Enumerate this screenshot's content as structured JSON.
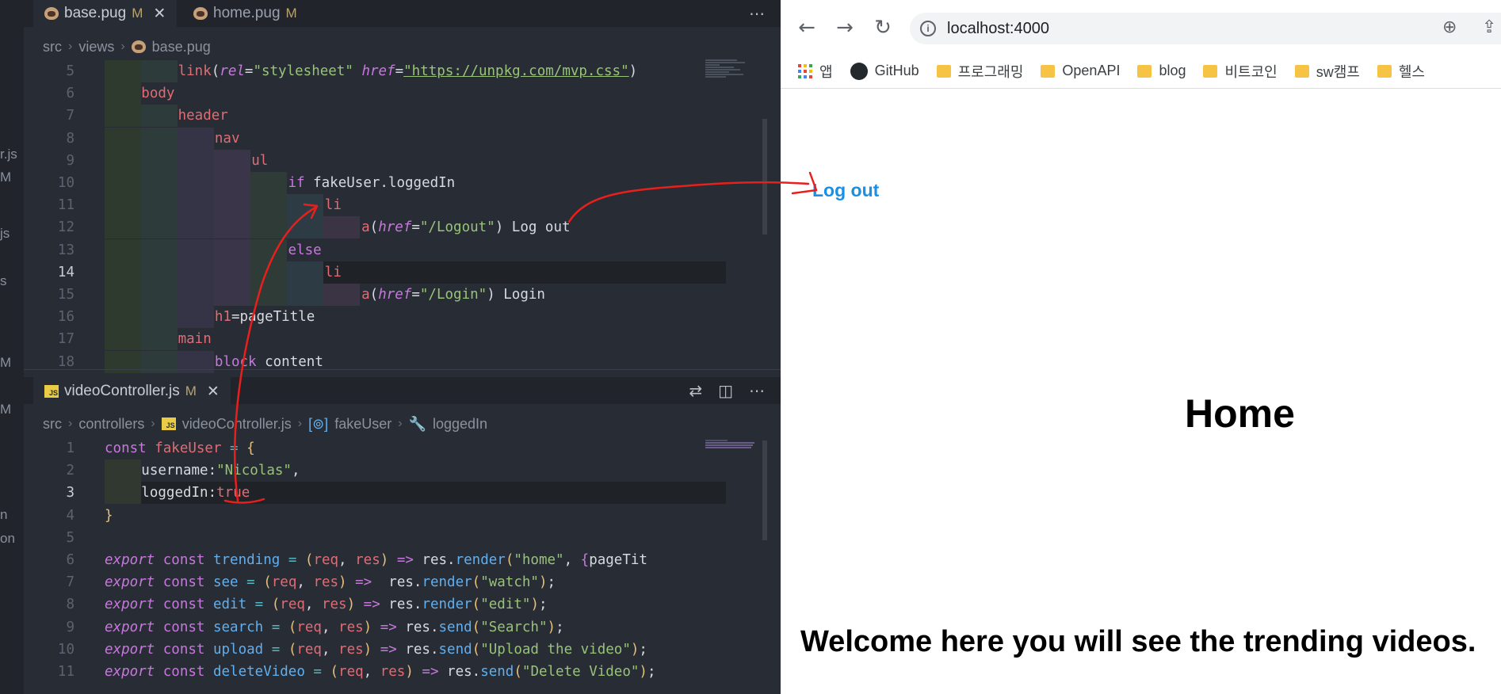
{
  "editor": {
    "top_tabs": [
      {
        "name": "base.pug",
        "status": "M",
        "active": true
      },
      {
        "name": "home.pug",
        "status": "M",
        "active": false
      }
    ],
    "top_breadcrumb": [
      "src",
      "views",
      "base.pug"
    ],
    "side_strip": [
      "r.js",
      "M",
      "js",
      "s",
      "M",
      "M",
      "n",
      "on"
    ],
    "pug_lines": [
      {
        "n": "5",
        "level": 2,
        "tokens": [
          [
            "link",
            "tag"
          ],
          [
            "(",
            "def"
          ],
          [
            "rel",
            "attr"
          ],
          [
            "=",
            "def"
          ],
          [
            "\"stylesheet\"",
            "def"
          ],
          [
            " ",
            "def"
          ],
          [
            "href",
            "attr"
          ],
          [
            "=",
            "def"
          ],
          [
            "\"https://unpkg.com/mvp.css\"",
            "def"
          ],
          [
            ")",
            "def"
          ]
        ]
      },
      {
        "n": "6",
        "level": 1,
        "tokens": [
          [
            "body",
            "tag"
          ]
        ]
      },
      {
        "n": "7",
        "level": 2,
        "tokens": [
          [
            "header",
            "tag"
          ]
        ]
      },
      {
        "n": "8",
        "level": 3,
        "tokens": [
          [
            "nav",
            "tag"
          ]
        ]
      },
      {
        "n": "9",
        "level": 4,
        "tokens": [
          [
            "ul",
            "tag"
          ]
        ]
      },
      {
        "n": "10",
        "level": 5,
        "tokens": [
          [
            "if ",
            "kw"
          ],
          [
            "fakeUser.loggedIn",
            "def"
          ]
        ]
      },
      {
        "n": "11",
        "level": 6,
        "tokens": [
          [
            "li",
            "tag"
          ]
        ]
      },
      {
        "n": "12",
        "level": 7,
        "tokens": [
          [
            "a",
            "tag"
          ],
          [
            "(",
            "def"
          ],
          [
            "href",
            "attr"
          ],
          [
            "=",
            "def"
          ],
          [
            "\"/Logout\"",
            "def"
          ],
          [
            ") Log out",
            "def"
          ]
        ]
      },
      {
        "n": "13",
        "level": 5,
        "tokens": [
          [
            "else",
            "kw"
          ]
        ]
      },
      {
        "n": "14",
        "level": 6,
        "current": true,
        "tokens": [
          [
            "li",
            "tag"
          ]
        ]
      },
      {
        "n": "15",
        "level": 7,
        "tokens": [
          [
            "a",
            "tag"
          ],
          [
            "(",
            "def"
          ],
          [
            "href",
            "attr"
          ],
          [
            "=",
            "def"
          ],
          [
            "\"/Login\"",
            "def"
          ],
          [
            ") Login",
            "def"
          ]
        ]
      },
      {
        "n": "16",
        "level": 3,
        "tokens": [
          [
            "h1",
            "tag"
          ],
          [
            "=pageTitle",
            "def"
          ]
        ]
      },
      {
        "n": "17",
        "level": 2,
        "tokens": [
          [
            "main",
            "tag"
          ]
        ]
      },
      {
        "n": "18",
        "level": 3,
        "tokens": [
          [
            "block ",
            "kw"
          ],
          [
            "content",
            "def"
          ]
        ]
      }
    ],
    "bottom_tab": {
      "name": "videoController.js",
      "status": "M"
    },
    "bottom_breadcrumb": [
      "src",
      "controllers",
      "videoController.js",
      "fakeUser",
      "loggedIn"
    ],
    "js_lines": [
      {
        "n": "1",
        "level": 0,
        "tokens": [
          [
            "const ",
            "kw"
          ],
          [
            "fakeUser",
            "param"
          ],
          [
            " = ",
            "op"
          ],
          [
            "{",
            "br"
          ]
        ]
      },
      {
        "n": "2",
        "level": 1,
        "tokens": [
          [
            "username",
            "def"
          ],
          [
            ":",
            "def"
          ],
          [
            "\"Nicolas\"",
            "str"
          ],
          [
            ",",
            "def"
          ]
        ]
      },
      {
        "n": "3",
        "level": 1,
        "current": true,
        "tokens": [
          [
            "loggedIn",
            "def"
          ],
          [
            ":",
            "def"
          ],
          [
            "true",
            "tag"
          ]
        ]
      },
      {
        "n": "4",
        "level": 0,
        "tokens": [
          [
            "}",
            "br"
          ]
        ]
      },
      {
        "n": "5",
        "level": 0,
        "tokens": []
      },
      {
        "n": "6",
        "level": 0,
        "tokens": [
          [
            "export ",
            "attr"
          ],
          [
            "const ",
            "kw"
          ],
          [
            "trending",
            "fn"
          ],
          [
            " = ",
            "op"
          ],
          [
            "(",
            "br"
          ],
          [
            "req",
            "param"
          ],
          [
            ", ",
            "def"
          ],
          [
            "res",
            "param"
          ],
          [
            ")",
            "br"
          ],
          [
            " => ",
            "kw"
          ],
          [
            "res.",
            "def"
          ],
          [
            "render",
            "fn"
          ],
          [
            "(",
            "br"
          ],
          [
            "\"home\"",
            "str"
          ],
          [
            ", ",
            "def"
          ],
          [
            "{",
            "kw"
          ],
          [
            "pageTit",
            "def"
          ]
        ]
      },
      {
        "n": "7",
        "level": 0,
        "tokens": [
          [
            "export ",
            "attr"
          ],
          [
            "const ",
            "kw"
          ],
          [
            "see",
            "fn"
          ],
          [
            " = ",
            "op"
          ],
          [
            "(",
            "br"
          ],
          [
            "req",
            "param"
          ],
          [
            ", ",
            "def"
          ],
          [
            "res",
            "param"
          ],
          [
            ")",
            "br"
          ],
          [
            " =>  ",
            "kw"
          ],
          [
            "res.",
            "def"
          ],
          [
            "render",
            "fn"
          ],
          [
            "(",
            "br"
          ],
          [
            "\"watch\"",
            "str"
          ],
          [
            ")",
            "br"
          ],
          [
            ";",
            "def"
          ]
        ]
      },
      {
        "n": "8",
        "level": 0,
        "tokens": [
          [
            "export ",
            "attr"
          ],
          [
            "const ",
            "kw"
          ],
          [
            "edit",
            "fn"
          ],
          [
            " = ",
            "op"
          ],
          [
            "(",
            "br"
          ],
          [
            "req",
            "param"
          ],
          [
            ", ",
            "def"
          ],
          [
            "res",
            "param"
          ],
          [
            ")",
            "br"
          ],
          [
            " => ",
            "kw"
          ],
          [
            "res.",
            "def"
          ],
          [
            "render",
            "fn"
          ],
          [
            "(",
            "br"
          ],
          [
            "\"edit\"",
            "str"
          ],
          [
            ")",
            "br"
          ],
          [
            ";",
            "def"
          ]
        ]
      },
      {
        "n": "9",
        "level": 0,
        "tokens": [
          [
            "export ",
            "attr"
          ],
          [
            "const ",
            "kw"
          ],
          [
            "search",
            "fn"
          ],
          [
            " = ",
            "op"
          ],
          [
            "(",
            "br"
          ],
          [
            "req",
            "param"
          ],
          [
            ", ",
            "def"
          ],
          [
            "res",
            "param"
          ],
          [
            ")",
            "br"
          ],
          [
            " => ",
            "kw"
          ],
          [
            "res.",
            "def"
          ],
          [
            "send",
            "fn"
          ],
          [
            "(",
            "br"
          ],
          [
            "\"Search\"",
            "str"
          ],
          [
            ")",
            "br"
          ],
          [
            ";",
            "def"
          ]
        ]
      },
      {
        "n": "10",
        "level": 0,
        "tokens": [
          [
            "export ",
            "attr"
          ],
          [
            "const ",
            "kw"
          ],
          [
            "upload",
            "fn"
          ],
          [
            " = ",
            "op"
          ],
          [
            "(",
            "br"
          ],
          [
            "req",
            "param"
          ],
          [
            ", ",
            "def"
          ],
          [
            "res",
            "param"
          ],
          [
            ")",
            "br"
          ],
          [
            " => ",
            "kw"
          ],
          [
            "res.",
            "def"
          ],
          [
            "send",
            "fn"
          ],
          [
            "(",
            "br"
          ],
          [
            "\"Upload the video\"",
            "str"
          ],
          [
            ")",
            "br"
          ],
          [
            ";",
            "def"
          ]
        ]
      },
      {
        "n": "11",
        "level": 0,
        "tokens": [
          [
            "export ",
            "attr"
          ],
          [
            "const ",
            "kw"
          ],
          [
            "deleteVideo",
            "fn"
          ],
          [
            " = ",
            "op"
          ],
          [
            "(",
            "br"
          ],
          [
            "req",
            "param"
          ],
          [
            ", ",
            "def"
          ],
          [
            "res",
            "param"
          ],
          [
            ")",
            "br"
          ],
          [
            " => ",
            "kw"
          ],
          [
            "res.",
            "def"
          ],
          [
            "send",
            "fn"
          ],
          [
            "(",
            "br"
          ],
          [
            "\"Delete Video\"",
            "str"
          ],
          [
            ")",
            "br"
          ],
          [
            ";",
            "def"
          ]
        ]
      }
    ]
  },
  "browser": {
    "url": "localhost:4000",
    "bookmarks": [
      {
        "label": "앱",
        "icon": "apps-grid-icon"
      },
      {
        "label": "GitHub",
        "icon": "github-icon"
      },
      {
        "label": "프로그래밍",
        "icon": "folder-icon"
      },
      {
        "label": "OpenAPI",
        "icon": "folder-icon"
      },
      {
        "label": "blog",
        "icon": "folder-icon"
      },
      {
        "label": "비트코인",
        "icon": "folder-icon"
      },
      {
        "label": "sw캠프",
        "icon": "folder-icon"
      },
      {
        "label": "헬스",
        "icon": "folder-icon"
      }
    ],
    "page": {
      "logout_link": "Log out",
      "heading": "Home",
      "welcome": "Welcome here you will see the trending videos."
    }
  },
  "colors": {
    "annotation": "#e8201c",
    "link": "#1a8fe6"
  }
}
